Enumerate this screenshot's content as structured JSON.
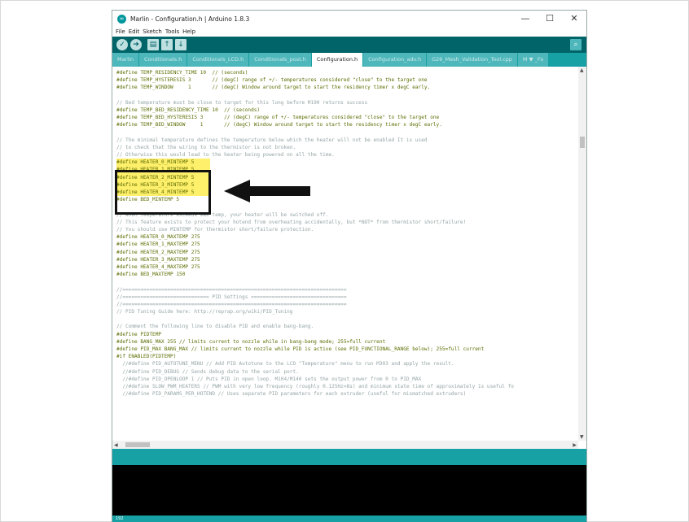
{
  "window": {
    "title": "Marlin - Configuration.h | Arduino 1.8.3",
    "minimize_label": "—",
    "maximize_label": "☐",
    "close_label": "✕"
  },
  "menu": [
    "File",
    "Edit",
    "Sketch",
    "Tools",
    "Help"
  ],
  "toolbar": {
    "verify_icon": "checkmark-icon",
    "upload_icon": "arrow-right-icon",
    "new_icon": "new-file-icon",
    "open_icon": "arrow-up-icon",
    "save_icon": "arrow-down-icon",
    "serial_icon": "magnifier-icon"
  },
  "tabs": [
    {
      "label": "Marlin",
      "active": false
    },
    {
      "label": "Conditionals.h",
      "active": false
    },
    {
      "label": "Conditionals_LCD.h",
      "active": false
    },
    {
      "label": "Conditionals_post.h",
      "active": false
    },
    {
      "label": "Configuration.h",
      "active": true
    },
    {
      "label": "Configuration_adv.h",
      "active": false
    },
    {
      "label": "G26_Mesh_Validation_Tool.cpp",
      "active": false
    },
    {
      "label": "M ▼ _Fo",
      "active": false
    }
  ],
  "code_lines": [
    "#define TEMP_RESIDENCY_TIME 10  // (seconds)",
    "#define TEMP_HYSTERESIS 3       // (degC) range of +/- temperatures considered \"close\" to the target one",
    "#define TEMP_WINDOW     1       // (degC) Window around target to start the residency timer x degC early.",
    "",
    "// Bed temperature must be close to target for this long before M190 returns success",
    "#define TEMP_BED_RESIDENCY_TIME 10  // (seconds)",
    "#define TEMP_BED_HYSTERESIS 3       // (degC) range of +/- temperatures considered \"close\" to the target one",
    "#define TEMP_BED_WINDOW     1       // (degC) Window around target to start the residency timer x degC early.",
    "",
    "// The minimal temperature defines the temperature below which the heater will not be enabled It is used",
    "// to check that the wiring to the thermistor is not broken.",
    "// Otherwise this would lead to the heater being powered on all the time.",
    "#define HEATER_0_MINTEMP 5",
    "#define HEATER_1_MINTEMP 5",
    "#define HEATER_2_MINTEMP 5",
    "#define HEATER_3_MINTEMP 5",
    "#define HEATER_4_MINTEMP 5",
    "#define BED_MINTEMP 5",
    "",
    "// When temperature exceeds max temp, your heater will be switched off.",
    "// This feature exists to protect your hotend from overheating accidentally, but *NOT* from thermistor short/failure!",
    "// You should use MINTEMP for thermistor short/failure protection.",
    "#define HEATER_0_MAXTEMP 275",
    "#define HEATER_1_MAXTEMP 275",
    "#define HEATER_2_MAXTEMP 275",
    "#define HEATER_3_MAXTEMP 275",
    "#define HEATER_4_MAXTEMP 275",
    "#define BED_MAXTEMP 150",
    "",
    "//===========================================================================",
    "//============================= PID Settings ================================",
    "//===========================================================================",
    "// PID Tuning Guide here: http://reprap.org/wiki/PID_Tuning",
    "",
    "// Comment the following line to disable PID and enable bang-bang.",
    "#define PIDTEMP",
    "#define BANG_MAX 255 // limits current to nozzle while in bang-bang mode; 255=full current",
    "#define PID_MAX BANG_MAX // limits current to nozzle while PID is active (see PID_FUNCTIONAL_RANGE below); 255=full current",
    "#if ENABLED(PIDTEMP)",
    "  //#define PID_AUTOTUNE_MENU // Add PID Autotune to the LCD \"Temperature\" menu to run M303 and apply the result.",
    "  //#define PID_DEBUG // Sends debug data to the serial port.",
    "  //#define PID_OPENLOOP 1 // Puts PID in open loop. M104/M140 sets the output power from 0 to PID_MAX",
    "  //#define SLOW_PWM_HEATERS // PWM with very low frequency (roughly 0.125Hz=8s) and minimum state time of approximately 1s useful fo",
    "  //#define PID_PARAMS_PER_HOTEND // Uses separate PID parameters for each extruder (useful for mismatched extruders)"
  ],
  "highlighted_lines": [
    12,
    13,
    14,
    15,
    16
  ],
  "status": {
    "line_number": "192"
  },
  "colors": {
    "toolbar": "#006468",
    "tabs": "#17a1a5",
    "highlight": "#fff06b"
  }
}
